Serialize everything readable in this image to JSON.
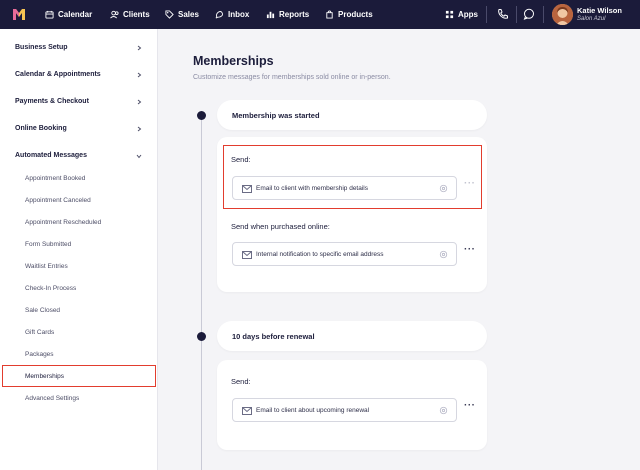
{
  "topbar": {
    "nav": [
      {
        "label": "Calendar",
        "icon": "calendar-icon"
      },
      {
        "label": "Clients",
        "icon": "clients-icon"
      },
      {
        "label": "Sales",
        "icon": "tag-icon"
      },
      {
        "label": "Inbox",
        "icon": "inbox-icon"
      },
      {
        "label": "Reports",
        "icon": "chart-icon"
      },
      {
        "label": "Products",
        "icon": "products-icon"
      }
    ],
    "apps_label": "Apps",
    "user": {
      "name": "Katie Wilson",
      "business": "Salon Azul"
    }
  },
  "sidebar": {
    "sections": [
      {
        "label": "Business Setup",
        "expanded": false
      },
      {
        "label": "Calendar & Appointments",
        "expanded": false
      },
      {
        "label": "Payments & Checkout",
        "expanded": false
      },
      {
        "label": "Online Booking",
        "expanded": false
      },
      {
        "label": "Automated Messages",
        "expanded": true
      }
    ],
    "items": [
      "Appointment Booked",
      "Appointment Canceled",
      "Appointment Rescheduled",
      "Form Submitted",
      "Waitlist Entries",
      "Check-In Process",
      "Sale Closed",
      "Gift Cards",
      "Packages",
      "Memberships",
      "Advanced Settings"
    ],
    "selected": "Memberships"
  },
  "main": {
    "title": "Memberships",
    "subtitle": "Customize messages for memberships sold online or in-person.",
    "events": [
      {
        "title": "Membership was started",
        "groups": [
          {
            "label": "Send:",
            "field": "Email to client with membership details"
          },
          {
            "label": "Send when purchased online:",
            "field": "Internal notification to specific email address"
          }
        ]
      },
      {
        "title": "10 days before renewal",
        "groups": [
          {
            "label": "Send:",
            "field": "Email to client about upcoming renewal"
          }
        ]
      }
    ]
  },
  "colors": {
    "topbar": "#1b1b3a",
    "highlight": "#e23d2e",
    "background": "#f4f4f7"
  }
}
